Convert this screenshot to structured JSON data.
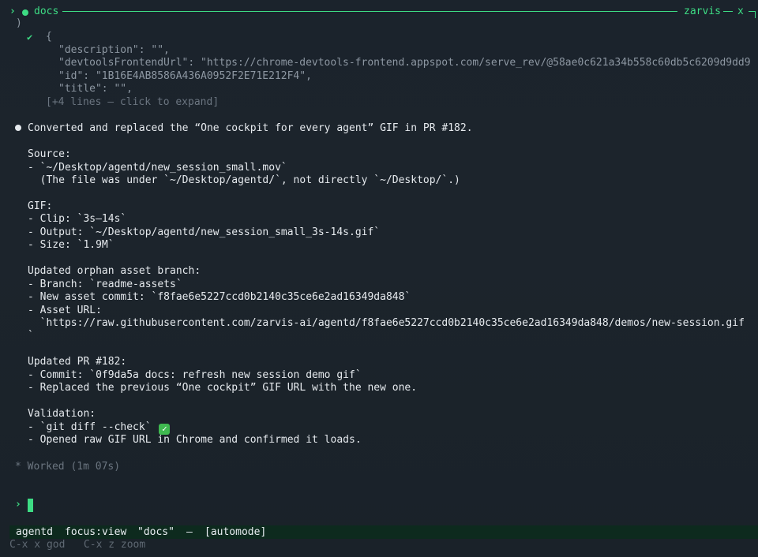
{
  "titlebar": {
    "prompt_chevron": "›",
    "title": "docs",
    "app_name": "zarvis",
    "close_label": "x"
  },
  "json_block": {
    "close_paren": ")",
    "check_glyph": "✔",
    "open_brace": "{",
    "lines": [
      "\"description\": \"\",",
      "\"devtoolsFrontendUrl\": \"https://chrome-devtools-frontend.appspot.com/serve_rev/@58ae0c621a34b558c60db5c6209d9dd9",
      "\"id\": \"1B16E4AB8586A436A0952F2E71E212F4\",",
      "\"title\": \"\","
    ],
    "expand_hint": "[+4 lines — click to expand]"
  },
  "message": {
    "headline": "Converted and replaced the “One cockpit for every agent” GIF in PR #182.",
    "source_heading": "Source:",
    "source_path": "- `~/Desktop/agentd/new_session_small.mov`",
    "source_note": "  (The file was under `~/Desktop/agentd/`, not directly `~/Desktop/`.)",
    "gif_heading": "GIF:",
    "gif_clip": "- Clip: `3s–14s`",
    "gif_output": "- Output: `~/Desktop/agentd/new_session_small_3s-14s.gif`",
    "gif_size": "- Size: `1.9M`",
    "branch_heading": "Updated orphan asset branch:",
    "branch_name": "- Branch: `readme-assets`",
    "branch_commit": "- New asset commit: `f8fae6e5227ccd0b2140c35ce6e2ad16349da848`",
    "branch_url_label": "- Asset URL:",
    "branch_url": "  `https://raw.githubusercontent.com/zarvis-ai/agentd/f8fae6e5227ccd0b2140c35ce6e2ad16349da848/demos/new-session.gif",
    "branch_url_tail": "`",
    "pr_heading": "Updated PR #182:",
    "pr_commit": "- Commit: `0f9da5a docs: refresh new session demo gif`",
    "pr_replaced": "- Replaced the previous “One cockpit” GIF URL with the new one.",
    "validation_heading": "Validation:",
    "validation_diff": "- `git diff --check` ",
    "validation_check_glyph": "✓",
    "validation_chrome": "- Opened raw GIF URL in Chrome and confirmed it loads."
  },
  "worked": "* Worked (1m 07s)",
  "prompt": {
    "chevron": "›"
  },
  "statusbar": {
    "app": "agentd",
    "focus": "focus:view",
    "view_name": "\"docs\"",
    "sep": "–",
    "mode": "[automode]"
  },
  "hints": "C-x x god   C-x z zoom",
  "colors": {
    "accent": "#3ddc84",
    "background": "#1b232b",
    "statusbar_bg": "#0d2a1e"
  }
}
